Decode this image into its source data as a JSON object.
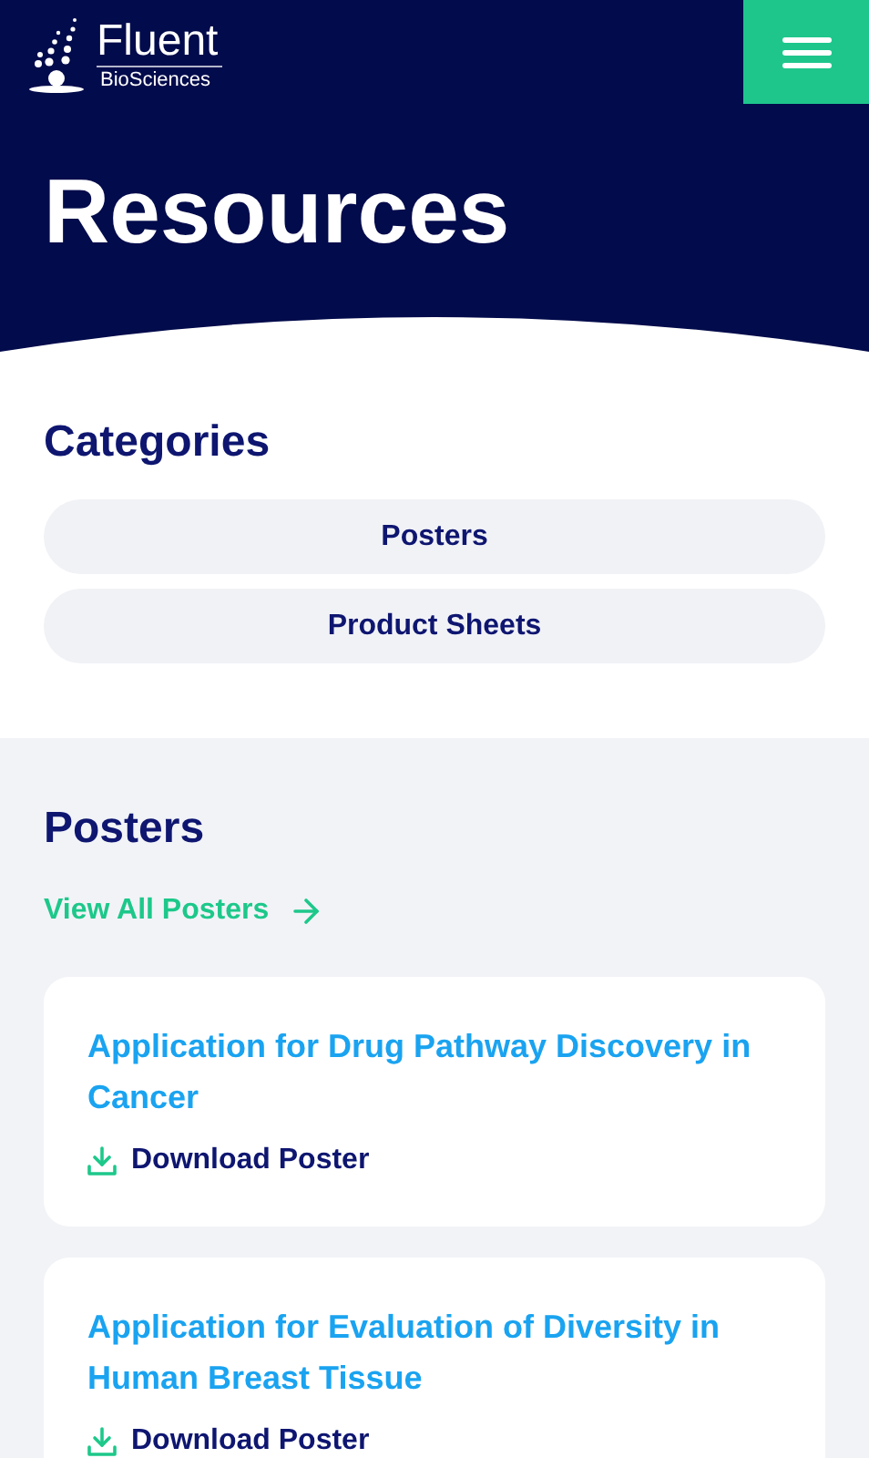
{
  "header": {
    "logo": {
      "name": "Fluent",
      "subtitle": "BioSciences"
    },
    "title": "Resources"
  },
  "categories": {
    "heading": "Categories",
    "items": [
      {
        "label": "Posters"
      },
      {
        "label": "Product Sheets"
      }
    ]
  },
  "posters": {
    "heading": "Posters",
    "view_all": "View All Posters",
    "cards": [
      {
        "title": "Application for Drug Pathway Discovery in Cancer",
        "action": "Download Poster"
      },
      {
        "title": "Application for Evaluation of Diversity in Human Breast Tissue",
        "action": "Download Poster"
      }
    ]
  }
}
